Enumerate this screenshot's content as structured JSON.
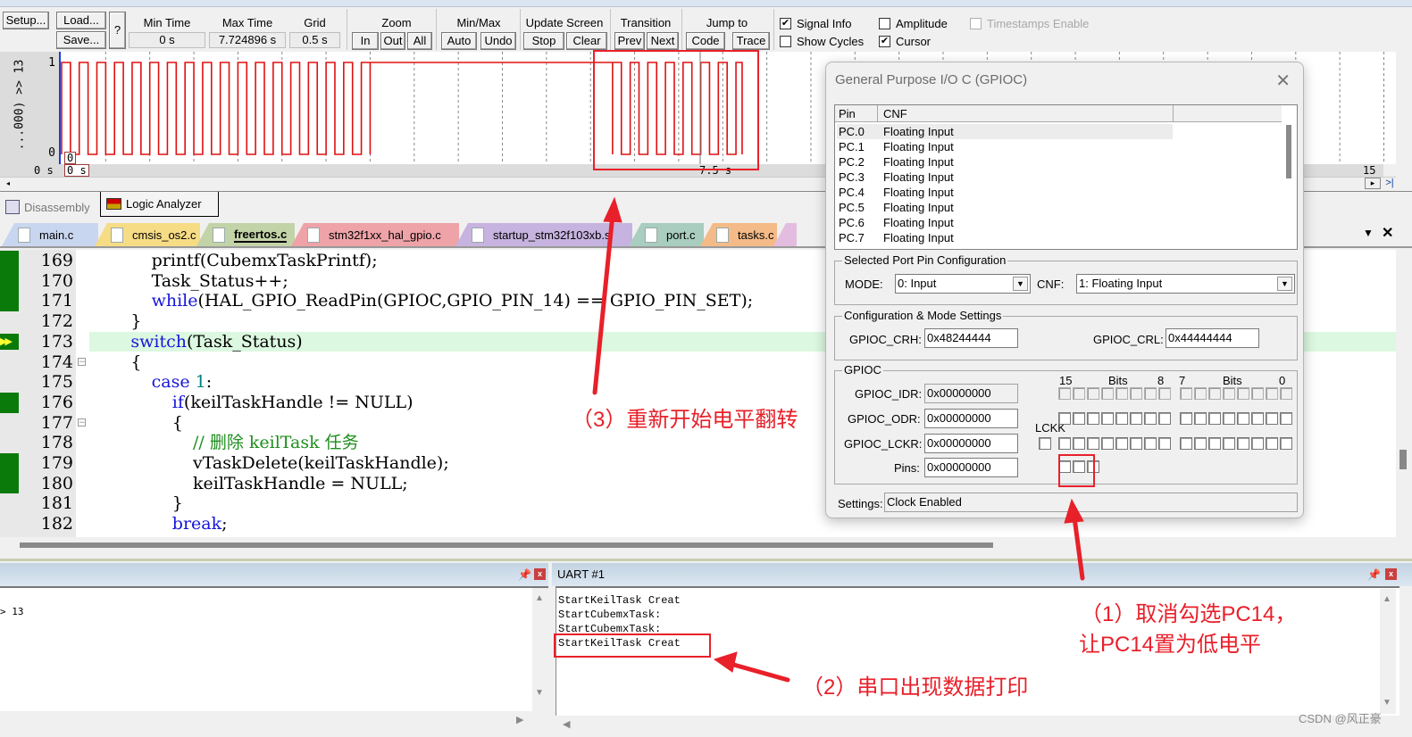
{
  "toolbar": {
    "setup": "Setup...",
    "load": "Load...",
    "save": "Save...",
    "help": "?",
    "min_time_label": "Min Time",
    "min_time_value": "0 s",
    "max_time_label": "Max Time",
    "max_time_value": "7.724896 s",
    "grid_label": "Grid",
    "grid_value": "0.5 s",
    "zoom_label": "Zoom",
    "zoom_in": "In",
    "zoom_out": "Out",
    "zoom_all": "All",
    "minmax_label": "Min/Max",
    "minmax_auto": "Auto",
    "minmax_undo": "Undo",
    "update_label": "Update Screen",
    "update_stop": "Stop",
    "update_clear": "Clear",
    "transition_label": "Transition",
    "transition_prev": "Prev",
    "transition_next": "Next",
    "jump_label": "Jump to",
    "jump_code": "Code",
    "jump_trace": "Trace",
    "checkboxes": [
      {
        "label": "Signal Info",
        "checked": true,
        "enabled": true
      },
      {
        "label": "Show Cycles",
        "checked": false,
        "enabled": true
      },
      {
        "label": "Amplitude",
        "checked": false,
        "enabled": true
      },
      {
        "label": "Cursor",
        "checked": true,
        "enabled": true
      },
      {
        "label": "Timestamps Enable",
        "checked": false,
        "enabled": false
      }
    ]
  },
  "logic_analyzer": {
    "signal_name": "...000) >> 13",
    "y_high": "1",
    "y_low": "0",
    "time_left": "0 s",
    "cursor_value": "0",
    "cursor_time": "0 s",
    "mid_time": "7.5 s",
    "time_right": "15 s",
    "nav_right": "▸",
    "nav_end": ">|",
    "signal_color": "#e01010",
    "waveform": {
      "time_range_s": [
        0,
        15
      ],
      "grid_s": 0.5,
      "segments": [
        {
          "type": "pulses",
          "start_s": 0.0,
          "end_s": 3.5,
          "period_s": 0.2,
          "high_s": 0.1
        },
        {
          "type": "high",
          "start_s": 3.5,
          "end_s": 6.25
        },
        {
          "type": "pulses",
          "start_s": 6.25,
          "end_s": 7.72,
          "period_s": 0.2,
          "high_s": 0.1
        }
      ]
    }
  },
  "panel_tabs": [
    {
      "label": "Disassembly",
      "active": false,
      "icon": "disassembly-icon"
    },
    {
      "label": "Logic Analyzer",
      "active": true,
      "icon": "logic-analyzer-icon"
    }
  ],
  "file_tabs": [
    {
      "label": "main.c",
      "color": "#c9d6ef",
      "active": false
    },
    {
      "label": "cmsis_os2.c",
      "color": "#f7dc86",
      "active": false
    },
    {
      "label": "freertos.c",
      "color": "#c3d3a8",
      "active": true
    },
    {
      "label": "stm32f1xx_hal_gpio.c",
      "color": "#eea3a8",
      "active": false
    },
    {
      "label": "startup_stm32f103xb.s",
      "color": "#c7b3df",
      "active": false
    },
    {
      "label": "port.c",
      "color": "#a9cdbf",
      "active": false
    },
    {
      "label": "tasks.c",
      "color": "#f4bb88",
      "active": false
    }
  ],
  "editor": {
    "lines": [
      {
        "num": "169",
        "bp": true,
        "fold": "",
        "indent": 3,
        "tokens": [
          [
            "t",
            "printf(CubemxTaskPrintf);"
          ]
        ]
      },
      {
        "num": "170",
        "bp": true,
        "fold": "",
        "indent": 3,
        "tokens": [
          [
            "t",
            "Task_Status++;"
          ]
        ]
      },
      {
        "num": "171",
        "bp": true,
        "fold": "",
        "indent": 3,
        "tokens": [
          [
            "k",
            "while"
          ],
          [
            "t",
            "(HAL_GPIO_ReadPin(GPIOC,GPIO_PIN_14) == GPIO_PIN_SET);"
          ]
        ]
      },
      {
        "num": "172",
        "bp": false,
        "fold": "end",
        "indent": 2,
        "tokens": [
          [
            "t",
            "}"
          ]
        ]
      },
      {
        "num": "173",
        "bp": false,
        "current": true,
        "fold": "",
        "indent": 2,
        "tokens": [
          [
            "k",
            "switch"
          ],
          [
            "t",
            "(Task_Status)"
          ]
        ]
      },
      {
        "num": "174",
        "bp": false,
        "fold": "start",
        "indent": 2,
        "tokens": [
          [
            "t",
            "{"
          ]
        ]
      },
      {
        "num": "175",
        "bp": false,
        "fold": "",
        "indent": 3,
        "tokens": [
          [
            "k",
            "case "
          ],
          [
            "n",
            "1"
          ],
          [
            "t",
            ":"
          ]
        ]
      },
      {
        "num": "176",
        "bp": true,
        "fold": "",
        "indent": 4,
        "tokens": [
          [
            "k",
            "if"
          ],
          [
            "t",
            "(keilTaskHandle != NULL)"
          ]
        ]
      },
      {
        "num": "177",
        "bp": false,
        "fold": "start",
        "indent": 4,
        "tokens": [
          [
            "t",
            "{"
          ]
        ]
      },
      {
        "num": "178",
        "bp": false,
        "fold": "",
        "indent": 5,
        "tokens": [
          [
            "c",
            "// 删除 keilTask 任务"
          ]
        ]
      },
      {
        "num": "179",
        "bp": true,
        "fold": "",
        "indent": 5,
        "tokens": [
          [
            "t",
            "vTaskDelete(keilTaskHandle);"
          ]
        ]
      },
      {
        "num": "180",
        "bp": true,
        "fold": "",
        "indent": 5,
        "tokens": [
          [
            "t",
            "keilTaskHandle = NULL;"
          ]
        ]
      },
      {
        "num": "181",
        "bp": false,
        "fold": "end",
        "indent": 4,
        "tokens": [
          [
            "t",
            "}"
          ]
        ]
      },
      {
        "num": "182",
        "bp": false,
        "fold": "",
        "indent": 4,
        "tokens": [
          [
            "k",
            "break"
          ],
          [
            "t",
            ";"
          ]
        ]
      }
    ]
  },
  "command_pane": {
    "title": "",
    "output": "> 13"
  },
  "uart_pane": {
    "title": "UART #1",
    "lines": [
      "StartKeilTask Creat",
      "StartCubemxTask:",
      "StartCubemxTask:",
      "StartKeilTask Creat"
    ]
  },
  "gpio_dialog": {
    "title": "General Purpose I/O C (GPIOC)",
    "columns": [
      "Pin",
      "CNF"
    ],
    "pins": [
      {
        "pin": "PC.0",
        "cnf": "Floating Input"
      },
      {
        "pin": "PC.1",
        "cnf": "Floating Input"
      },
      {
        "pin": "PC.2",
        "cnf": "Floating Input"
      },
      {
        "pin": "PC.3",
        "cnf": "Floating Input"
      },
      {
        "pin": "PC.4",
        "cnf": "Floating Input"
      },
      {
        "pin": "PC.5",
        "cnf": "Floating Input"
      },
      {
        "pin": "PC.6",
        "cnf": "Floating Input"
      },
      {
        "pin": "PC.7",
        "cnf": "Floating Input"
      }
    ],
    "selected_group": "Selected Port Pin Configuration",
    "mode_label": "MODE:",
    "mode_value": "0: Input",
    "cnf_label": "CNF:",
    "cnf_value": "1: Floating Input",
    "config_group": "Configuration & Mode Settings",
    "crh_label": "GPIOC_CRH:",
    "crh_value": "0x48244444",
    "crl_label": "GPIOC_CRL:",
    "crl_value": "0x44444444",
    "gpio_group": "GPIOC",
    "bits_hi_left": "15",
    "bits_label": "Bits",
    "bits_hi_right": "8",
    "bits_lo_left": "7",
    "bits_lo_right": "0",
    "idr_label": "GPIOC_IDR:",
    "idr_value": "0x00000000",
    "odr_label": "GPIOC_ODR:",
    "odr_value": "0x00000000",
    "lckk_label": "LCKK",
    "lckr_label": "GPIOC_LCKR:",
    "lckr_value": "0x00000000",
    "pins_label": "Pins:",
    "pins_value": "0x00000000",
    "settings_label": "Settings:",
    "settings_value": "Clock Enabled"
  },
  "annotations": {
    "note1_line1": "（1）取消勾选PC14，",
    "note1_line2": "让PC14置为低电平",
    "note2": "（2）串口出现数据打印",
    "note3": "（3）重新开始电平翻转",
    "color": "#e8202a"
  },
  "watermark": "CSDN @风正豪"
}
